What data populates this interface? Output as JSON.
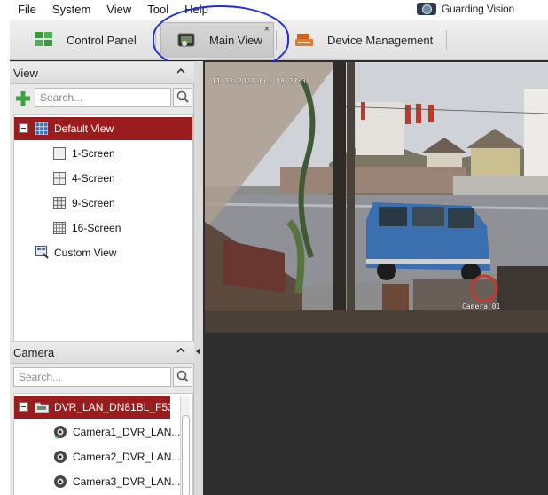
{
  "menu": [
    "File",
    "System",
    "View",
    "Tool",
    "Help"
  ],
  "brand": {
    "name": "Guarding Vision"
  },
  "tabs": [
    {
      "label": "Control Panel",
      "icon": "control-panel-icon"
    },
    {
      "label": "Main View",
      "icon": "main-view-icon",
      "active": true,
      "close": "×"
    },
    {
      "label": "Device Management",
      "icon": "device-management-icon"
    }
  ],
  "view_panel": {
    "title": "View",
    "search_placeholder": "Search...",
    "tree": [
      {
        "label": "Default View",
        "selected": true,
        "icon": "grid-view-icon"
      },
      {
        "label": "1-Screen",
        "icon": "one-screen-icon"
      },
      {
        "label": "4-Screen",
        "icon": "four-screen-icon"
      },
      {
        "label": "9-Screen",
        "icon": "nine-screen-icon"
      },
      {
        "label": "16-Screen",
        "icon": "sixteen-screen-icon"
      },
      {
        "label": "Custom View",
        "icon": "custom-view-icon"
      }
    ]
  },
  "camera_panel": {
    "title": "Camera",
    "search_placeholder": "Search...",
    "tree": [
      {
        "label": "DVR_LAN_DN81BL_F53...",
        "selected": true,
        "icon": "dvr-folder-icon"
      },
      {
        "label": "Camera1_DVR_LAN...",
        "icon": "camera-icon"
      },
      {
        "label": "Camera2_DVR_LAN...",
        "icon": "camera-icon"
      },
      {
        "label": "Camera3_DVR_LAN...",
        "icon": "camera-icon"
      }
    ]
  },
  "video": {
    "timestamp": "11-12-2021 Fri 08:27:3",
    "camera_label": "Camera 01"
  },
  "colors": {
    "selection": "#9b1c1c",
    "annotation": "#1e2fd6",
    "van": "#3a6fb0"
  }
}
